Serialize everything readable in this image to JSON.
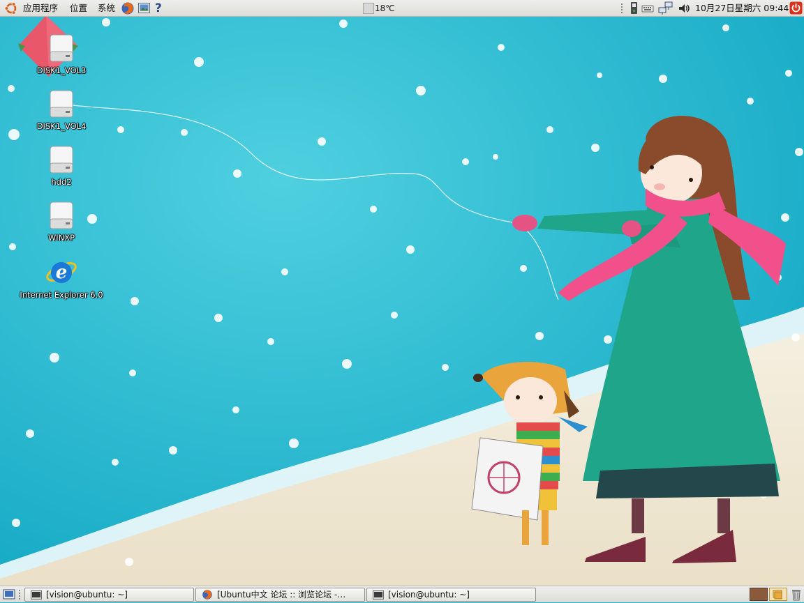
{
  "top_panel": {
    "menus": [
      "应用程序",
      "位置",
      "系统"
    ],
    "weather": "18℃",
    "clock": "10月27日星期六 09:44"
  },
  "desktop": {
    "icons": [
      {
        "label": "DISK1_VOL3",
        "icon": "drive-icon"
      },
      {
        "label": "DISK1_VOL4",
        "icon": "drive-icon"
      },
      {
        "label": "hdd2",
        "icon": "drive-icon"
      },
      {
        "label": "WINXP",
        "icon": "drive-icon"
      },
      {
        "label": "Internet Explorer 6.0",
        "icon": "internet-explorer-icon"
      }
    ]
  },
  "taskbar": {
    "tasks": [
      {
        "label": "[vision@ubuntu: ~]",
        "icon": "terminal-icon"
      },
      {
        "label": "[Ubuntu中文 论坛 :: 浏览论坛 -…",
        "icon": "firefox-icon"
      },
      {
        "label": "[vision@ubuntu: ~]",
        "icon": "terminal-icon"
      }
    ]
  },
  "colors": {
    "sea": "#20b8cf",
    "sand": "#f1ead8",
    "scarf": "#f2508a",
    "coat": "#1fa58a"
  }
}
